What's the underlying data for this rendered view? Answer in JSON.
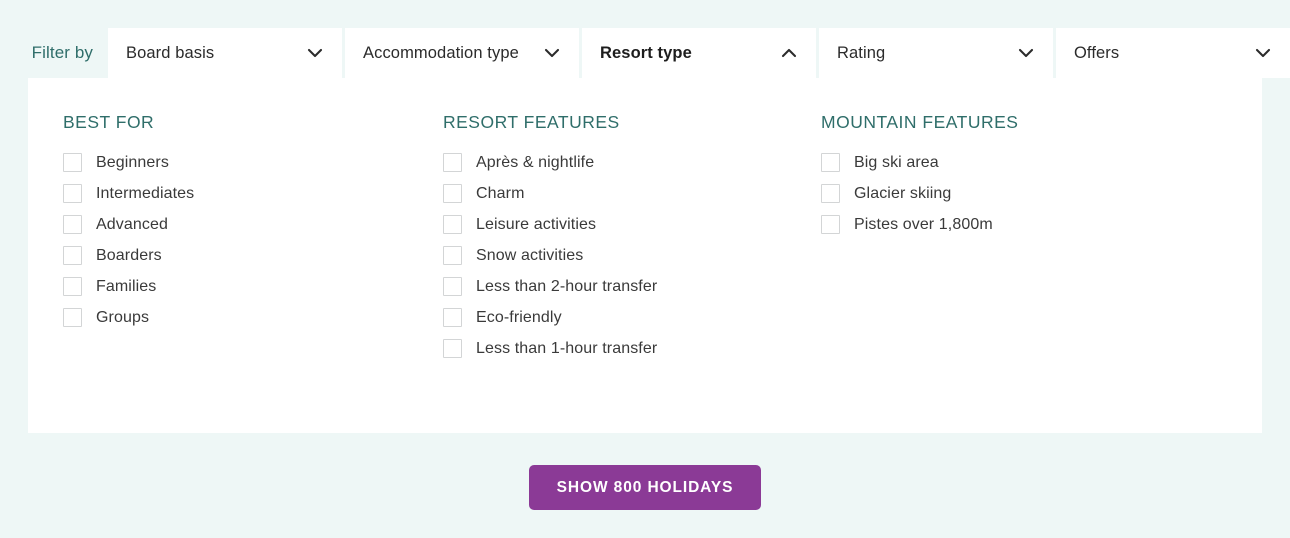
{
  "colors": {
    "page_background": "#eef7f6",
    "panel_background": "#ffffff",
    "teal_accent": "#2f6e6a",
    "cta_purple": "#8b3a96",
    "checkbox_border": "#d3d5d6",
    "text": "#3a3a3a"
  },
  "filter_bar": {
    "label": "Filter by",
    "tabs": [
      {
        "label": "Board basis",
        "expanded": false,
        "icon": "chevron-down-icon"
      },
      {
        "label": "Accommodation type",
        "expanded": false,
        "icon": "chevron-down-icon"
      },
      {
        "label": "Resort type",
        "expanded": true,
        "icon": "chevron-up-icon"
      },
      {
        "label": "Rating",
        "expanded": false,
        "icon": "chevron-down-icon"
      },
      {
        "label": "Offers",
        "expanded": false,
        "icon": "chevron-down-icon"
      }
    ]
  },
  "panel": {
    "columns": [
      {
        "heading": "BEST FOR",
        "options": [
          {
            "label": "Beginners",
            "checked": false
          },
          {
            "label": "Intermediates",
            "checked": false
          },
          {
            "label": "Advanced",
            "checked": false
          },
          {
            "label": "Boarders",
            "checked": false
          },
          {
            "label": "Families",
            "checked": false
          },
          {
            "label": "Groups",
            "checked": false
          }
        ]
      },
      {
        "heading": "RESORT FEATURES",
        "options": [
          {
            "label": "Après & nightlife",
            "checked": false
          },
          {
            "label": "Charm",
            "checked": false
          },
          {
            "label": "Leisure activities",
            "checked": false
          },
          {
            "label": "Snow activities",
            "checked": false
          },
          {
            "label": "Less than 2-hour transfer",
            "checked": false
          },
          {
            "label": "Eco-friendly",
            "checked": false
          },
          {
            "label": "Less than 1-hour transfer",
            "checked": false
          }
        ]
      },
      {
        "heading": "MOUNTAIN FEATURES",
        "options": [
          {
            "label": "Big ski area",
            "checked": false
          },
          {
            "label": "Glacier skiing",
            "checked": false
          },
          {
            "label": "Pistes over 1,800m",
            "checked": false
          }
        ]
      }
    ]
  },
  "cta": {
    "label": "SHOW 800 HOLIDAYS",
    "count": 800
  }
}
